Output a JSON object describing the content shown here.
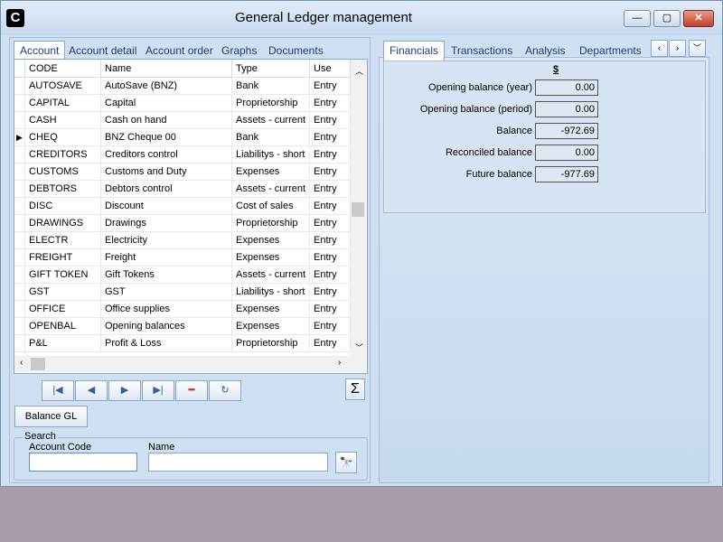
{
  "window": {
    "title": "General Ledger management",
    "app_icon_letter": "C",
    "minimize": "—",
    "maximize": "▢",
    "close": "✕"
  },
  "left_tabs": [
    "Account",
    "Account detail",
    "Account order",
    "Graphs",
    "Documents"
  ],
  "right_tabs": [
    "Financials",
    "Transactions",
    "Analysis",
    "Departments"
  ],
  "grid": {
    "columns": [
      "CODE",
      "Name",
      "Type",
      "Use"
    ],
    "rows": [
      [
        "AUTOSAVE",
        "AutoSave (BNZ)",
        "Bank",
        "Entry"
      ],
      [
        "CAPITAL",
        "Capital",
        "Proprietorship",
        "Entry"
      ],
      [
        "CASH",
        "Cash on hand",
        "Assets - current",
        "Entry"
      ],
      [
        "CHEQ",
        "BNZ Cheque 00",
        "Bank",
        "Entry"
      ],
      [
        "CREDITORS",
        "Creditors control",
        "Liabilitys - short",
        "Entry"
      ],
      [
        "CUSTOMS",
        "Customs and Duty",
        "Expenses",
        "Entry"
      ],
      [
        "DEBTORS",
        "Debtors control",
        "Assets - current",
        "Entry"
      ],
      [
        "DISC",
        "Discount",
        "Cost of sales",
        "Entry"
      ],
      [
        "DRAWINGS",
        "Drawings",
        "Proprietorship",
        "Entry"
      ],
      [
        "ELECTR",
        "Electricity",
        "Expenses",
        "Entry"
      ],
      [
        "FREIGHT",
        "Freight",
        "Expenses",
        "Entry"
      ],
      [
        "GIFT TOKEN",
        "Gift Tokens",
        "Assets - current",
        "Entry"
      ],
      [
        "GST",
        "GST",
        "Liabilitys - short",
        "Entry"
      ],
      [
        "OFFICE",
        "Office supplies",
        "Expenses",
        "Entry"
      ],
      [
        "OPENBAL",
        "Opening balances",
        "Expenses",
        "Entry"
      ],
      [
        "P&L",
        "Profit & Loss",
        "Proprietorship",
        "Entry"
      ]
    ],
    "current_row_marker": "▶"
  },
  "nav": {
    "first": "|◀",
    "prev": "◀",
    "next": "▶",
    "last": "▶|",
    "delete": "━",
    "refresh": "↻",
    "sum": "Σ"
  },
  "balance_button": "Balance GL",
  "search": {
    "legend": "Search",
    "code_label": "Account Code",
    "name_label": "Name",
    "code_value": "",
    "name_value": "",
    "find_icon": "🔭"
  },
  "financials": {
    "currency": "$",
    "rows": [
      {
        "label": "Opening balance (year)",
        "value": "0.00"
      },
      {
        "label": "Opening balance (period)",
        "value": "0.00"
      },
      {
        "label": "Balance",
        "value": "-972.69"
      },
      {
        "label": "Reconciled balance",
        "value": "0.00"
      },
      {
        "label": "Future balance",
        "value": "-977.69"
      }
    ]
  }
}
